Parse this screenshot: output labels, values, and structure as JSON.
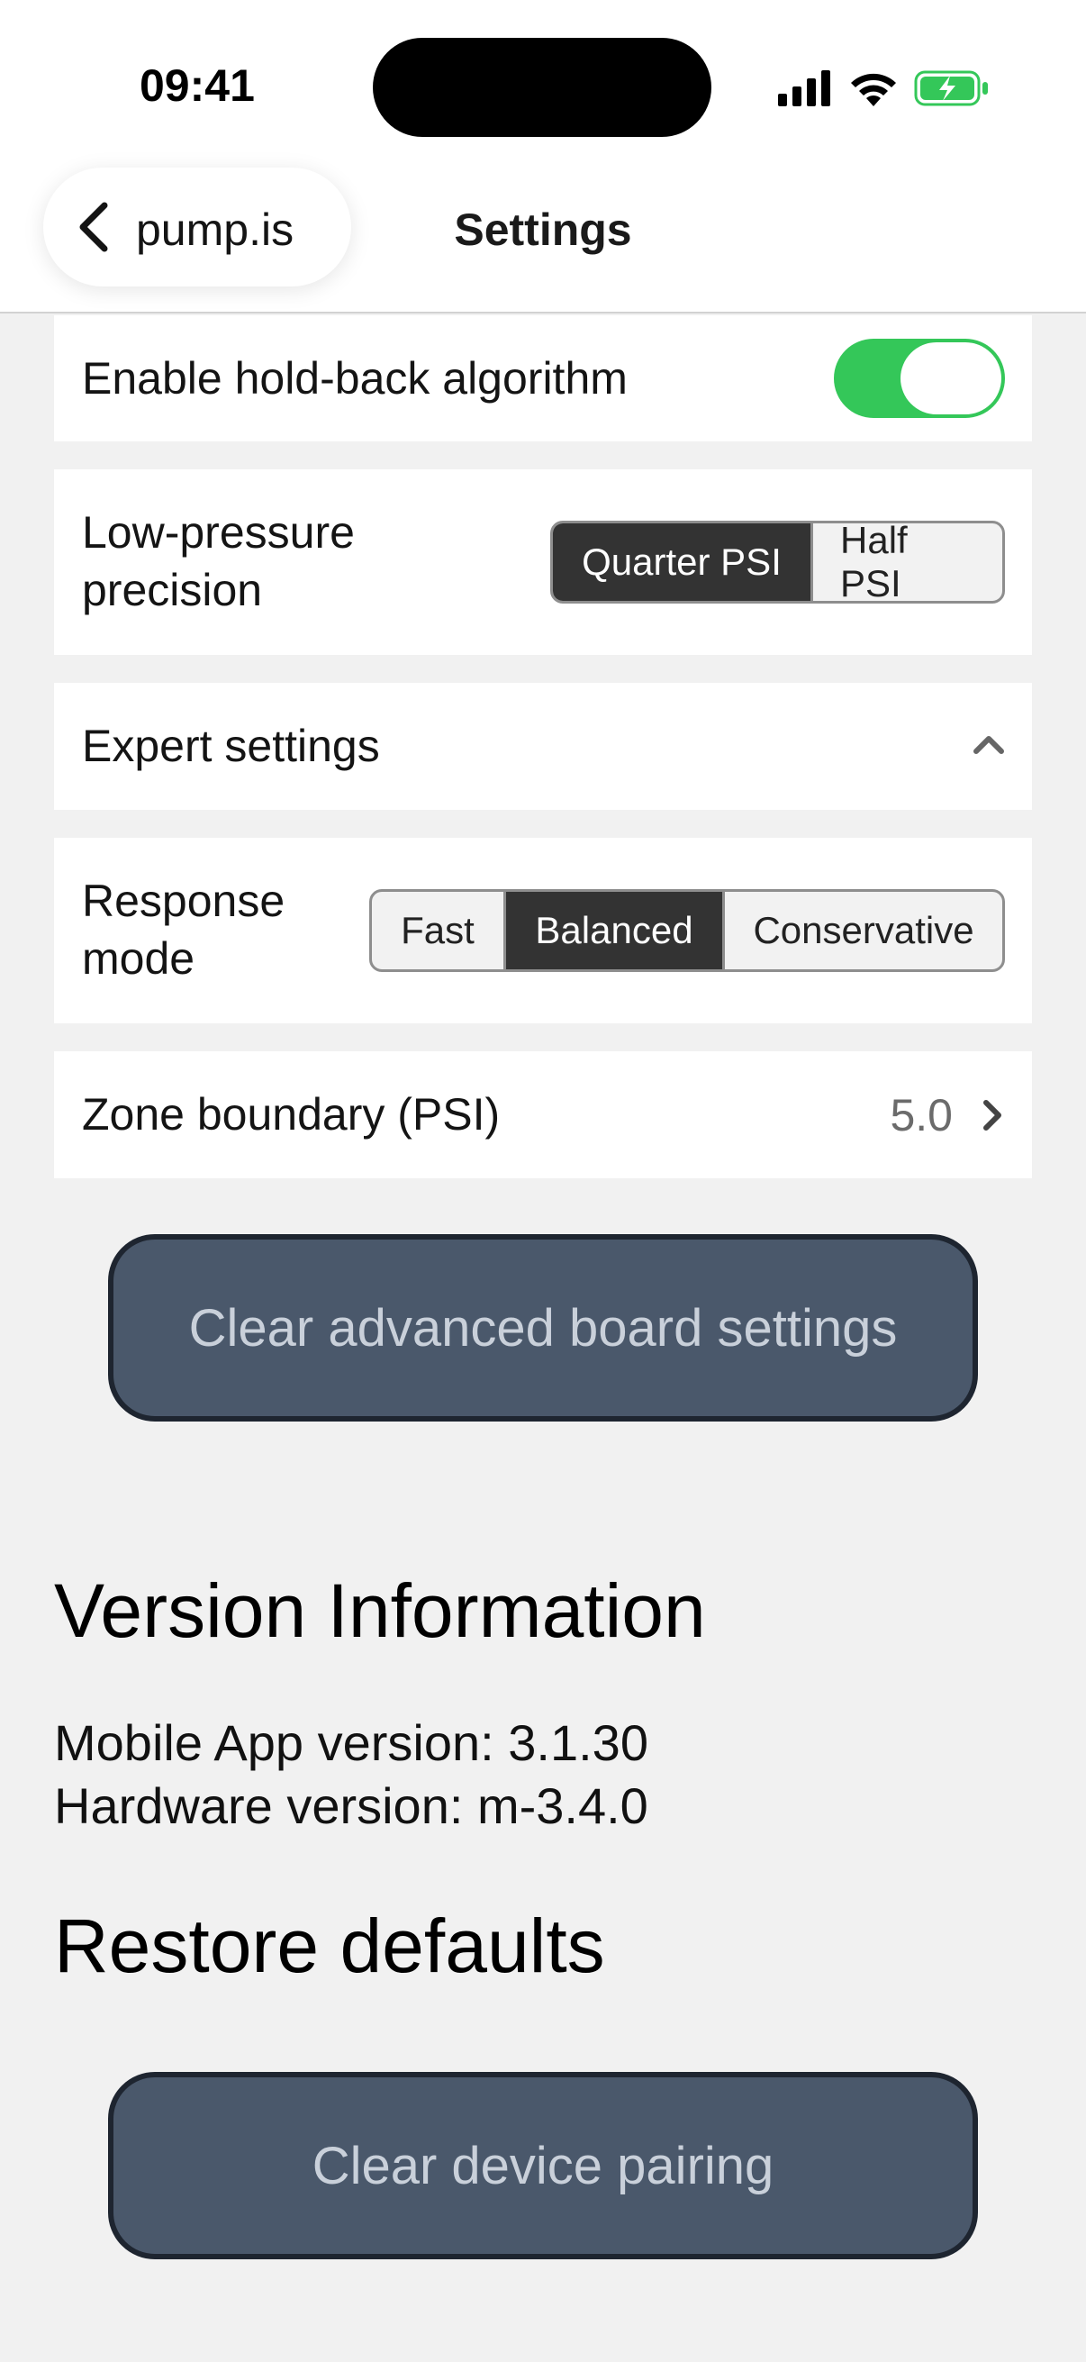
{
  "status_bar": {
    "time": "09:41",
    "signal_icon": "cellular-signal-icon",
    "wifi_icon": "wifi-icon",
    "battery_icon": "battery-charging-icon",
    "battery_color": "#34c759"
  },
  "nav": {
    "back_label": "pump.is",
    "title": "Settings"
  },
  "settings": {
    "hold_back": {
      "label": "Enable hold-back algorithm",
      "enabled": true
    },
    "low_pressure": {
      "label_line1": "Low-pressure",
      "label_line2": "precision",
      "options": [
        "Quarter PSI",
        "Half PSI"
      ],
      "selected": "Quarter PSI"
    },
    "expert": {
      "label": "Expert settings",
      "expanded": true
    },
    "response_mode": {
      "label_line1": "Response",
      "label_line2": "mode",
      "options": [
        "Fast",
        "Balanced",
        "Conservative"
      ],
      "selected": "Balanced"
    },
    "zone_boundary": {
      "label": "Zone boundary (PSI)",
      "value": "5.0"
    },
    "clear_advanced_label": "Clear advanced board settings"
  },
  "version": {
    "title": "Version Information",
    "mobile_app": "Mobile App version: 3.1.30",
    "hardware": "Hardware version: m-3.4.0"
  },
  "restore": {
    "title": "Restore defaults",
    "clear_pairing_label": "Clear device pairing"
  },
  "colors": {
    "toggle_on": "#34c759",
    "segment_active": "#333333",
    "button_bg": "#4a586b",
    "button_text": "#c9d0da"
  }
}
